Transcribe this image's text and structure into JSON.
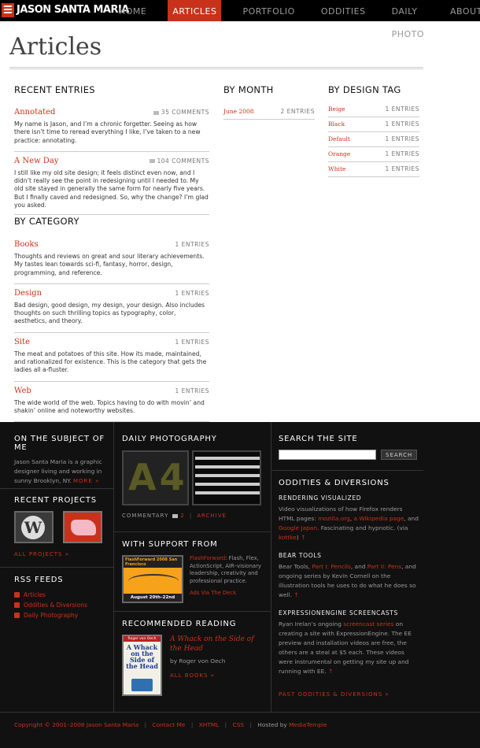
{
  "site": {
    "name": "Jason Santa Maria"
  },
  "nav": [
    "Home",
    "Articles",
    "Portfolio",
    "Oddities",
    "Daily Photo",
    "About"
  ],
  "page_title": "Articles",
  "recent": {
    "heading": "Recent Entries",
    "entries": [
      {
        "title": "Annotated",
        "meta": "35 Comments",
        "text": "My name is Jason, and I’m a chronic forgetter. Seeing as how there isn’t time to reread everything I like, I’ve taken to a new practice: annotating."
      },
      {
        "title": "A New Day",
        "meta": "104 Comments",
        "text": "I still like my old site design; it feels distinct even now, and I didn’t really see the point in redesigning until I needed to. My old site stayed in generally the same form for nearly five years. But I finally caved and redesigned. So, why the change? I’m glad you asked."
      }
    ]
  },
  "month": {
    "heading": "By Month",
    "rows": [
      {
        "label": "June 2008",
        "count": "2 Entries"
      }
    ]
  },
  "tags": {
    "heading": "By Design Tag",
    "rows": [
      {
        "label": "Beige",
        "count": "1 Entries"
      },
      {
        "label": "Black",
        "count": "1 Entries"
      },
      {
        "label": "Default",
        "count": "1 Entries"
      },
      {
        "label": "Orange",
        "count": "1 Entries"
      },
      {
        "label": "White",
        "count": "1 Entries"
      }
    ]
  },
  "category": {
    "heading": "By Category",
    "items": [
      {
        "title": "Books",
        "meta": "1 Entries",
        "text": "Thoughts and reviews on great and sour literary achievements. My tastes lean towards sci-fi, fantasy, horror, design, programming, and reference."
      },
      {
        "title": "Design",
        "meta": "1 Entries",
        "text": "Bad design, good design, my design, your design. Also includes thoughts on such thrilling topics as typography, color, aesthetics, and theory."
      },
      {
        "title": "Site",
        "meta": "1 Entries",
        "text": "The meat and potatoes of this site. How its made, maintained, and rationalized for existence. This is the category that gets the ladies all a-fluster."
      },
      {
        "title": "Web",
        "meta": "1 Entries",
        "text": "The wide world of the web. Topics having to do with movin’ and shakin’ online and noteworthy websites."
      }
    ]
  },
  "footer": {
    "about": {
      "heading": "On the Subject of Me",
      "text": "Jason Santa Maria is a graphic designer living and working in sunny Brooklyn, NY.",
      "more": "More »"
    },
    "projects": {
      "heading": "Recent Projects",
      "all": "All Projects »"
    },
    "rss": {
      "heading": "RSS Feeds",
      "items": [
        "Articles",
        "Oddities & Diversions",
        "Daily Photography"
      ]
    },
    "photo": {
      "heading": "Daily Photography",
      "commentary": "Commentary",
      "count": "2",
      "archive": "Archive"
    },
    "support": {
      "heading": "With Support From",
      "ad_title": "FlashForward 2008 San Francisco",
      "ad_date": "August 20th–22nd",
      "link": "FlashForward",
      "text": ": Flash, Flex, ActionScript, AIR–visionary leadership, creativity and professional practice.",
      "via": "Ads Via The Deck"
    },
    "reading": {
      "heading": "Recommended Reading",
      "title": "A Whack on the Side of the Head",
      "author": "by Roger von Oech",
      "all": "All Books »",
      "cover_author": "Roger von Oech",
      "cover_title": "A Whack on the Side of the Head"
    },
    "search": {
      "heading": "Search the Site",
      "button": "Search",
      "placeholder": ""
    },
    "oddities": {
      "heading": "Oddities & Diversions",
      "items": [
        {
          "title": "Rendering Visualized",
          "p1": "Video visualizations of how Firefox renders HTML pages: ",
          "l1": "mozilla.org",
          "s1": ", ",
          "l2": "a Wikipedia page",
          "s2": ", and ",
          "l3": "Google Japan",
          "s3": ". Fascinating and hypnotic. (via ",
          "l4": "kottke",
          "s4": ")"
        },
        {
          "title": "Bear Tools",
          "p1": "Bear Tools, ",
          "l1": "Part I: Pencils",
          "s1": ", and ",
          "l2": "Part II: Pens",
          "s2": ", and ongoing series by Kevin Cornell on the illustration tools he uses to do what he does so well."
        },
        {
          "title": "ExpressionEngine Screencasts",
          "p1": "Ryan Irelan’s ongoing ",
          "l1": "screencast series",
          "s1": " on creating a site with ExpressionEngine. The EE preview and installation videos are free, the others are a steal at $5 each. These videos were instrumental on getting my site up and running with EE."
        }
      ],
      "past": "Past Oddities & Diversions »"
    },
    "copyright": {
      "pre": "Copyright © 2001–2008",
      "name": "Jason Santa Maria",
      "contact": "Contact Me",
      "xhtml": "XHTML",
      "css": "CSS",
      "hosted": "Hosted by",
      "host": "MediaTemple"
    }
  },
  "colors": {
    "accent": "#c8321a",
    "footer_bg": "#111111"
  }
}
